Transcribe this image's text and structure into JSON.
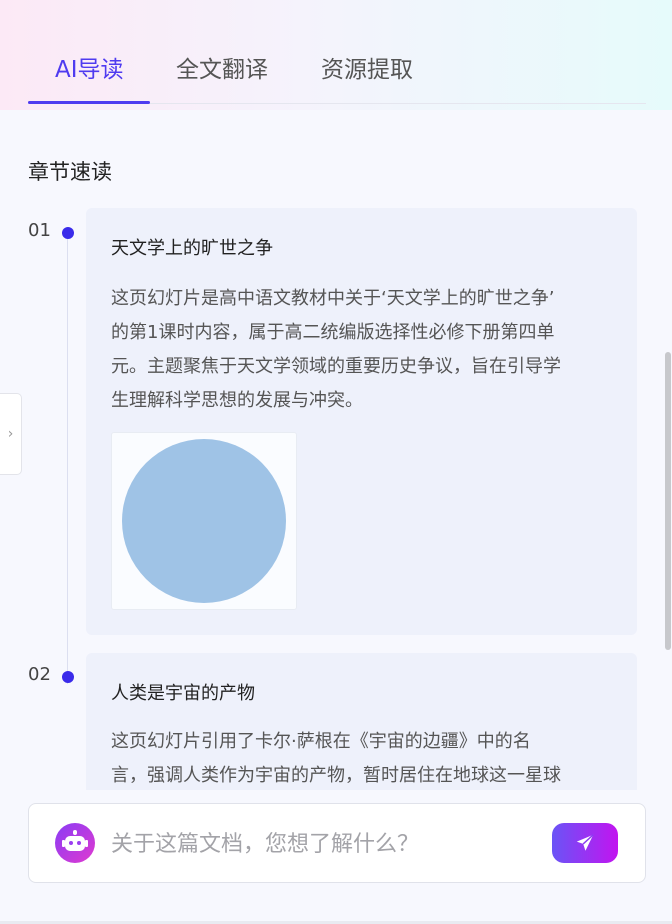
{
  "tabs": [
    {
      "label": "AI导读",
      "active": true
    },
    {
      "label": "全文翻译",
      "active": false
    },
    {
      "label": "资源提取",
      "active": false
    }
  ],
  "section_title": "章节速读",
  "chapters": [
    {
      "number": "01",
      "title": "天文学上的旷世之争",
      "lines": [
        "这页幻灯片是高中语文教材中关于‘天文学上的旷世之争’",
        "的第1课时内容，属于高二统编版选择性必修下册第四单",
        "元。主题聚焦于天文学领域的重要历史争议，旨在引导学",
        "生理解科学思想的发展与冲突。"
      ]
    },
    {
      "number": "02",
      "title": "人类是宇宙的产物",
      "lines": [
        "这页幻灯片引用了卡尔·萨根在《宇宙的边疆》中的名",
        "言，强调人类作为宇宙的产物，暂时居住在地球这一星球"
      ]
    }
  ],
  "side_toggle": {
    "icon": "chevron-right-icon",
    "glyph": "›"
  },
  "chat": {
    "placeholder": "关于这篇文档，您想了解什么？",
    "avatar_icon": "robot-icon",
    "send_icon": "paper-plane-icon"
  },
  "colors": {
    "accent": "#4f3bf0",
    "timeline_dot": "#3a2bea",
    "card_bg": "#eef1fb",
    "send_gradient_start": "#6a54f6",
    "send_gradient_end": "#c214f0"
  }
}
